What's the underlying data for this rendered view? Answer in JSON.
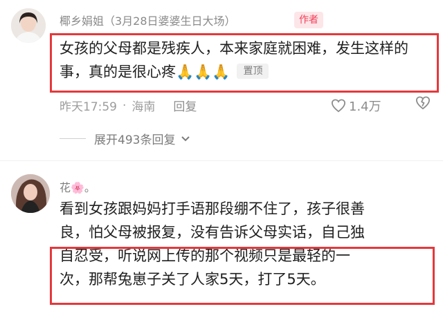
{
  "comment1": {
    "username": "椰乡娟姐（3月28日婆婆生日大场）",
    "author_badge": "作者",
    "text": "女孩的父母都是残疾人，本来家庭就困难，发生这样的事，真的是很心疼",
    "emoji": "🙏🙏🙏",
    "pin_label": "置顶",
    "time": "昨天17:59",
    "location": "海南",
    "reply_label": "回复",
    "like_count": "1.4万",
    "expand_label": "展开493条回复"
  },
  "comment2": {
    "username": "花🌸。",
    "text_line1": "看到女孩跟妈妈打手语那段绷不住了，孩子很善",
    "text_line2": "良，怕父母被报复，没有告诉父母实话，自己独",
    "text_line3": "自忍受，听说网上传的那个视频只是最轻的一",
    "text_line4": "次，那帮兔崽子关了人家5天，打了5天。"
  },
  "icons": {
    "like": "heart-icon",
    "dislike": "broken-heart-icon",
    "expand": "chevron-down-icon"
  },
  "colors": {
    "highlight_box": "#e5383b",
    "author_badge_text": "#f2405a",
    "author_badge_bg": "#fde6e8"
  }
}
